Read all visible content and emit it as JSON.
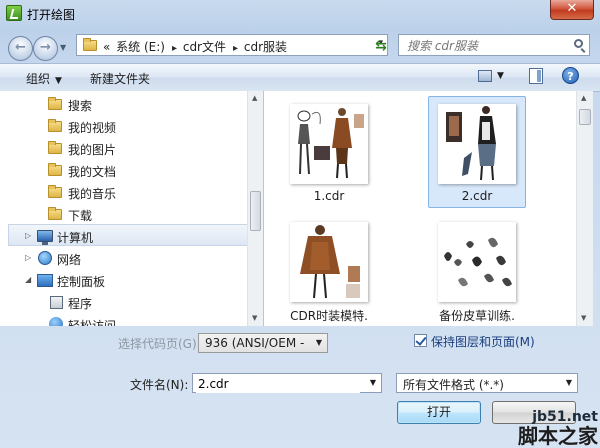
{
  "window": {
    "title": "打开绘图"
  },
  "address": {
    "crumbs": [
      "«",
      "系统 (E:)",
      "cdr文件",
      "cdr服装"
    ],
    "search_placeholder": "搜索 cdr服装"
  },
  "toolbar": {
    "organize": "组织",
    "new_folder": "新建文件夹"
  },
  "nav": {
    "items": [
      {
        "label": "搜索",
        "icon": "folder-icon"
      },
      {
        "label": "我的视频",
        "icon": "folder-icon"
      },
      {
        "label": "我的图片",
        "icon": "folder-icon"
      },
      {
        "label": "我的文档",
        "icon": "folder-icon"
      },
      {
        "label": "我的音乐",
        "icon": "folder-icon"
      },
      {
        "label": "下载",
        "icon": "folder-icon"
      },
      {
        "label": "计算机",
        "icon": "computer-icon"
      },
      {
        "label": "网络",
        "icon": "network-icon"
      },
      {
        "label": "控制面板",
        "icon": "control-panel-icon"
      },
      {
        "label": "程序",
        "icon": "program-icon"
      },
      {
        "label": "轻松访问",
        "icon": "ease-of-access-icon"
      }
    ],
    "selected": "计算机"
  },
  "files": [
    {
      "name": "1.cdr",
      "selected": false
    },
    {
      "name": "2.cdr",
      "selected": true
    },
    {
      "name": "CDR时装模特.",
      "selected": false
    },
    {
      "name": "备份皮草训练.",
      "selected": false
    }
  ],
  "options": {
    "code_page_label": "选择代码页(G)",
    "code_page_value": "936   (ANSI/OEM -",
    "keep_layers_label": "保持图层和页面(M)",
    "keep_layers_checked": true
  },
  "filename": {
    "label": "文件名(N):",
    "value": "2.cdr"
  },
  "filetype": {
    "value": "所有文件格式 (*.*)"
  },
  "buttons": {
    "open": "打开"
  },
  "watermark": {
    "line1": "jb51.net",
    "line2": "脚本之家"
  }
}
